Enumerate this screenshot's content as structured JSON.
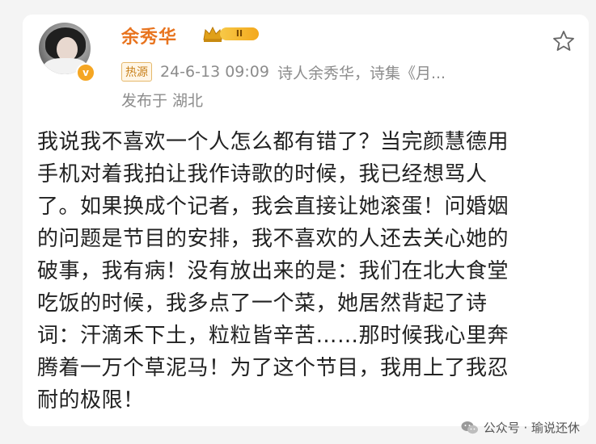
{
  "post": {
    "author": "余秀华",
    "level_badge": "II",
    "source_badge": "热源",
    "timestamp": "24-6-13 09:09",
    "source_text": "诗人余秀华，诗集《月...",
    "location": "发布于 湖北",
    "verified_mark": "v",
    "content": "我说我不喜欢一个人怎么都有错了？当完颜慧德用\n手机对着我拍让我作诗歌的时候，我已经想骂人\n了。如果换成个记者，我会直接让她滚蛋！问婚姻\n的问题是节目的安排，我不喜欢的人还去关心她的\n破事，我有病！没有放出来的是：我们在北大食堂\n吃饭的时候，我多点了一个菜，她居然背起了诗\n词：汗滴禾下土，粒粒皆辛苦……那时候我心里奔\n腾着一万个草泥马！为了这个节目，我用上了我忍\n耐的极限！"
  },
  "watermark": {
    "label": "公众号 · 瑜说还休",
    "icon": "wechat-icon"
  },
  "colors": {
    "author_name": "#e8741f",
    "meta_text": "#8c8c8c",
    "level_gold": "#f3a81c"
  }
}
